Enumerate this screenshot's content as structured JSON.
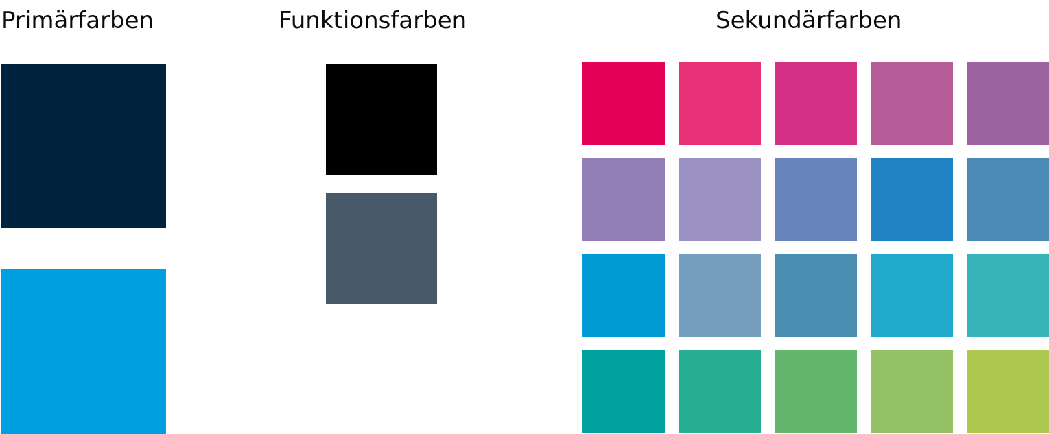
{
  "groups": {
    "primary": {
      "title": "Primärfarben",
      "colors": [
        "#00233e",
        "#009fe0"
      ]
    },
    "functional": {
      "title": "Funktionsfarben",
      "colors": [
        "#000000",
        "#485a6a"
      ]
    },
    "secondary": {
      "title": "Sekundärfarben",
      "colors": [
        "#e30059",
        "#e63178",
        "#d52f86",
        "#b65c98",
        "#9b64a0",
        "#937eb5",
        "#9b91c3",
        "#6684bb",
        "#1f82c2",
        "#4b89b6",
        "#009bd5",
        "#749dbe",
        "#4c8eb1",
        "#22aacc",
        "#37b4b7",
        "#00a19e",
        "#26ad91",
        "#63b46c",
        "#93c163",
        "#aec94f"
      ]
    }
  }
}
